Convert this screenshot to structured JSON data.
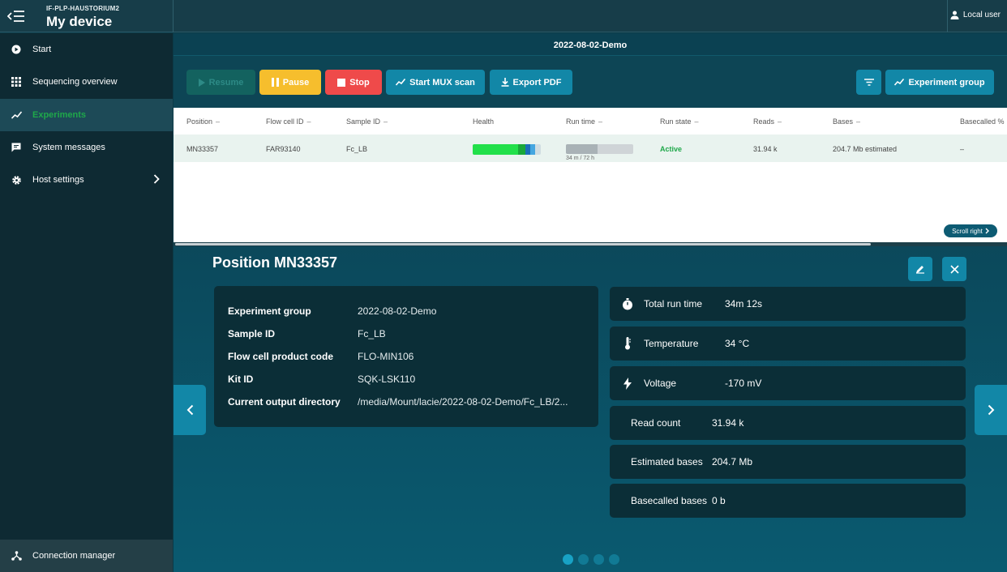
{
  "header": {
    "device_id": "IF-PLP-HAUSTORIUM2",
    "title": "My device",
    "user": "Local user"
  },
  "sidebar": {
    "items": [
      {
        "label": "Start",
        "icon": "play-circle-icon"
      },
      {
        "label": "Sequencing overview",
        "icon": "grid-icon"
      },
      {
        "label": "Experiments",
        "icon": "chart-line-icon"
      },
      {
        "label": "System messages",
        "icon": "message-icon"
      },
      {
        "label": "Host settings",
        "icon": "gear-icon"
      }
    ],
    "footer": "Connection manager"
  },
  "experiment": {
    "title": "2022-08-02-Demo"
  },
  "toolbar": {
    "resume": "Resume",
    "pause": "Pause",
    "stop": "Stop",
    "mux": "Start MUX scan",
    "pdf": "Export PDF",
    "group": "Experiment group"
  },
  "table": {
    "headers": [
      "Position",
      "Flow cell ID",
      "Sample ID",
      "Health",
      "Run time",
      "Run state",
      "Reads",
      "Bases",
      "Basecalled %"
    ],
    "row": {
      "position": "MN33357",
      "flow_cell": "FAR93140",
      "sample": "Fc_LB",
      "run_time": "34 m / 72 h",
      "run_fraction": 0.47,
      "run_state": "Active",
      "reads": "31.94 k",
      "bases": "204.7 Mb estimated",
      "basecalled": "–"
    },
    "scroll_right": "Scroll right"
  },
  "detail": {
    "title": "Position MN33357",
    "info": [
      {
        "label": "Experiment group",
        "value": "2022-08-02-Demo"
      },
      {
        "label": "Sample ID",
        "value": "Fc_LB"
      },
      {
        "label": "Flow cell product code",
        "value": "FLO-MIN106"
      },
      {
        "label": "Kit ID",
        "value": "SQK-LSK110"
      },
      {
        "label": "Current output directory",
        "value": "/media/Mount/lacie/2022-08-02-Demo/Fc_LB/2..."
      }
    ],
    "stats": [
      {
        "label": "Total run time",
        "value": "34m 12s"
      },
      {
        "label": "Temperature",
        "value": "34 °C"
      },
      {
        "label": "Voltage",
        "value": "-170 mV"
      },
      {
        "label": "Read count",
        "value": "31.94 k"
      },
      {
        "label": "Estimated bases",
        "value": "204.7 Mb"
      },
      {
        "label": "Basecalled bases",
        "value": "0 b"
      }
    ]
  },
  "colors": {
    "accent": "#1287a7",
    "pause": "#f6be2d",
    "stop": "#ef4a4a",
    "active": "#1fa84a"
  }
}
